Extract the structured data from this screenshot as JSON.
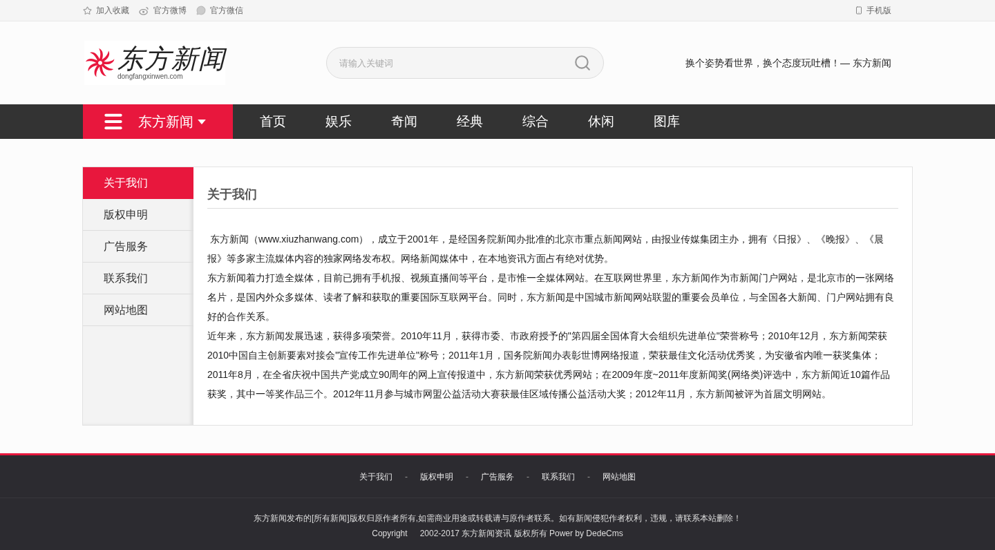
{
  "topbar": {
    "links": [
      {
        "kind": "star",
        "label": "加入收藏"
      },
      {
        "kind": "weibo",
        "label": "官方微博"
      },
      {
        "kind": "wechat",
        "label": "官方微信"
      }
    ],
    "mobile": "手机版"
  },
  "header": {
    "logo": {
      "name": "东方新闻",
      "domain": "dongfangxinwen.com"
    },
    "search": {
      "placeholder": "请输入关键词"
    },
    "slogan": "换个姿势看世界，换个态度玩吐槽！— 东方新闻"
  },
  "nav": {
    "brand": "东方新闻",
    "items": [
      "首页",
      "娱乐",
      "奇闻",
      "经典",
      "综合",
      "休闲",
      "图库"
    ]
  },
  "sidebar": {
    "items": [
      {
        "label": "关于我们",
        "selected": true
      },
      {
        "label": "版权申明",
        "selected": false
      },
      {
        "label": "广告服务",
        "selected": false
      },
      {
        "label": "联系我们",
        "selected": false
      },
      {
        "label": "网站地图",
        "selected": false
      }
    ]
  },
  "article": {
    "title": "关于我们",
    "paragraphs": [
      " 东方新闻（www.xiuzhanwang.com），成立于2001年，是经国务院新闻办批准的北京市重点新闻网站，由报业传媒集团主办，拥有《日报》、《晚报》、《晨报》等多家主流媒体内容的独家网络发布权。网络新闻媒体中，在本地资讯方面占有绝对优势。",
      "东方新闻着力打造全媒体，目前已拥有手机报、视频直播间等平台，是市惟一全媒体网站。在互联网世界里，东方新闻作为市新闻门户网站，是北京市的一张网络名片，是国内外众多媒体、读者了解和获取的重要国际互联网平台。同时，东方新闻是中国城市新闻网站联盟的重要会员单位，与全国各大新闻、门户网站拥有良好的合作关系。",
      "近年来，东方新闻发展迅速，获得多项荣誉。2010年11月，获得市委、市政府授予的\"第四届全国体育大会组织先进单位\"荣誉称号；2010年12月，东方新闻荣获2010中国自主创新要素对接会\"宣传工作先进单位\"称号；2011年1月，国务院新闻办表彰世博网络报道，荣获最佳文化活动优秀奖，为安徽省内唯一获奖集体；2011年8月，在全省庆祝中国共产党成立90周年的网上宣传报道中，东方新闻荣获优秀网站；在2009年度~2011年度新闻奖(网络类)评选中，东方新闻近10篇作品获奖，其中一等奖作品三个。2012年11月参与城市网盟公益活动大赛获最佳区域传播公益活动大奖；2012年11月，东方新闻被评为首届文明网站。"
    ]
  },
  "footer": {
    "nav": [
      {
        "kind": "link",
        "text": "关于我们"
      },
      {
        "kind": "separator",
        "text": "-"
      },
      {
        "kind": "link",
        "text": "版权申明"
      },
      {
        "kind": "separator",
        "text": "-"
      },
      {
        "kind": "link",
        "text": "广告服务"
      },
      {
        "kind": "separator",
        "text": "-"
      },
      {
        "kind": "link",
        "text": "联系我们"
      },
      {
        "kind": "separator",
        "text": "-"
      },
      {
        "kind": "link",
        "text": "网站地图"
      }
    ],
    "notice": "东方新闻发布的[所有新闻]版权归原作者所有,如需商业用途或转载请与原作者联系。如有新闻侵犯作者权利，违规，请联系本站删除！",
    "copyright": "Copyright",
    "rights": "2002-2017 东方新闻资讯 版权所有 Power by DedeCms"
  }
}
